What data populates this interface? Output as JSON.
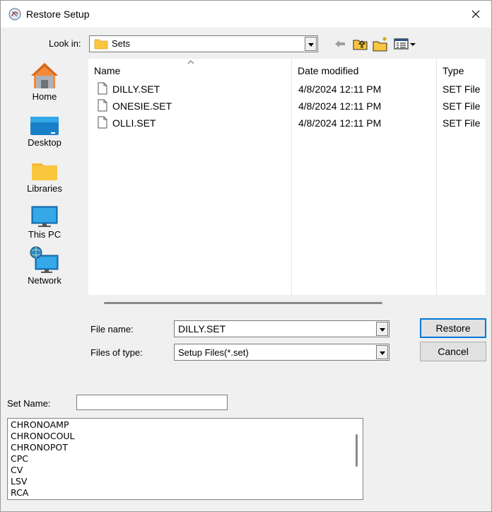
{
  "window": {
    "title": "Restore Setup"
  },
  "lookin": {
    "label": "Look in:",
    "value": "Sets"
  },
  "places": [
    {
      "label": "Home",
      "icon": "home-icon"
    },
    {
      "label": "Desktop",
      "icon": "desktop-icon"
    },
    {
      "label": "Libraries",
      "icon": "libraries-icon"
    },
    {
      "label": "This PC",
      "icon": "this-pc-icon"
    },
    {
      "label": "Network",
      "icon": "network-icon"
    }
  ],
  "columns": {
    "name": "Name",
    "date": "Date modified",
    "type": "Type"
  },
  "files": [
    {
      "name": "DILLY.SET",
      "date": "4/8/2024 12:11 PM",
      "type": "SET File"
    },
    {
      "name": "ONESIE.SET",
      "date": "4/8/2024 12:11 PM",
      "type": "SET File"
    },
    {
      "name": "OLLI.SET",
      "date": "4/8/2024 12:11 PM",
      "type": "SET File"
    }
  ],
  "filename": {
    "label": "File name:",
    "value": "DILLY.SET"
  },
  "filetype": {
    "label": "Files of type:",
    "value": "Setup Files(*.set)"
  },
  "buttons": {
    "restore": "Restore",
    "cancel": "Cancel"
  },
  "setname": {
    "label": "Set Name:",
    "value": ""
  },
  "techniques": [
    "CHRONOAMP",
    "CHRONOCOUL",
    "CHRONOPOT",
    "CPC",
    "CV",
    "LSV",
    "RCA"
  ],
  "colors": {
    "accent": "#0078d7",
    "folder": "#f8c73e"
  }
}
